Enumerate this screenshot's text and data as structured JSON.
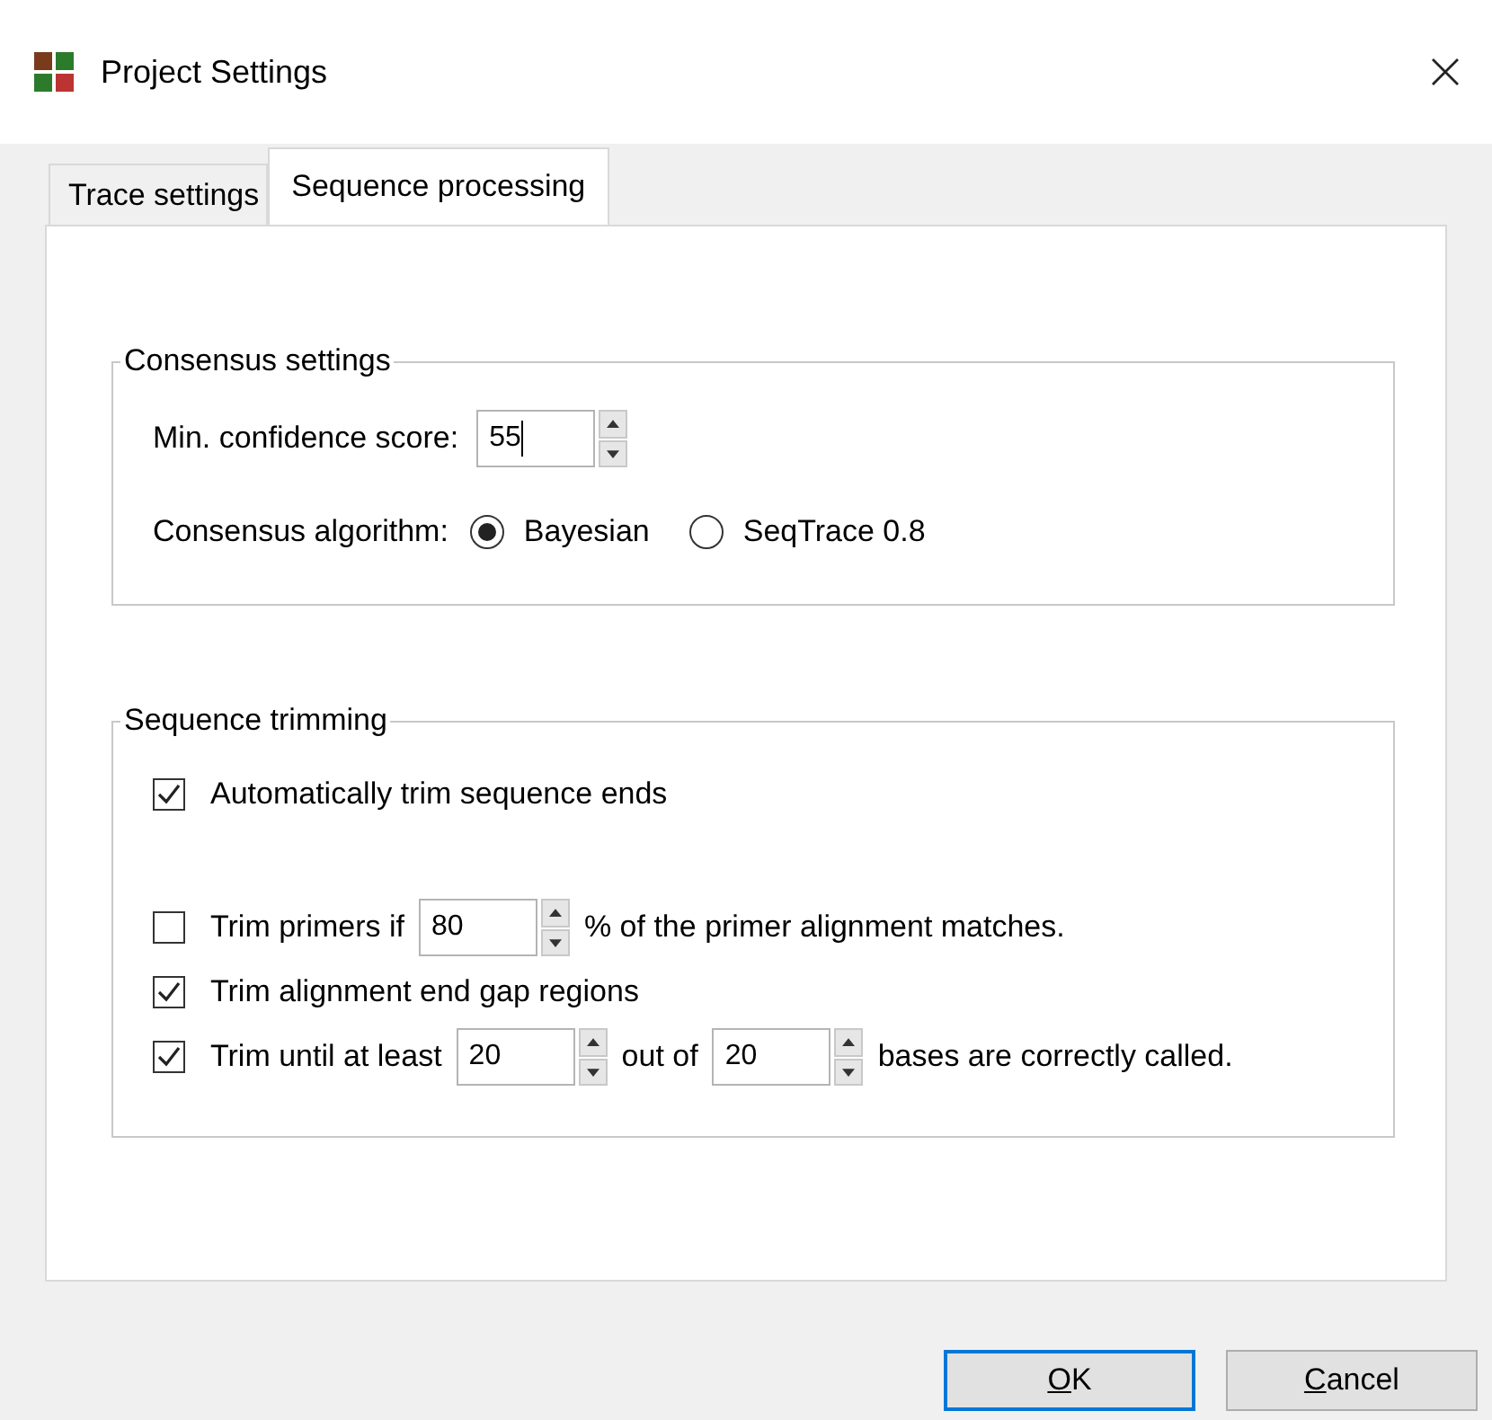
{
  "window": {
    "title": "Project Settings"
  },
  "tabs": [
    {
      "label": "Trace settings",
      "selected": false
    },
    {
      "label": "Sequence processing",
      "selected": true
    }
  ],
  "consensus_settings": {
    "title": "Consensus settings",
    "min_confidence": {
      "label": "Min. confidence score:",
      "value": "55",
      "focused": true
    },
    "algorithm": {
      "label": "Consensus algorithm:",
      "options": [
        {
          "label": "Bayesian",
          "selected": true
        },
        {
          "label": "SeqTrace 0.8",
          "selected": false
        }
      ]
    }
  },
  "sequence_trimming": {
    "title": "Sequence trimming",
    "rows": [
      {
        "checked": true,
        "parts": [
          {
            "kind": "text",
            "text": "Automatically trim sequence ends"
          }
        ]
      },
      {
        "checked": false,
        "parts": [
          {
            "kind": "text",
            "text": "Trim primers if"
          },
          {
            "kind": "spin",
            "value": "80"
          },
          {
            "kind": "text",
            "text": "% of the primer alignment matches."
          }
        ]
      },
      {
        "checked": true,
        "parts": [
          {
            "kind": "text",
            "text": "Trim alignment end gap regions"
          }
        ]
      },
      {
        "checked": true,
        "parts": [
          {
            "kind": "text",
            "text": "Trim until at least"
          },
          {
            "kind": "spin",
            "value": "20"
          },
          {
            "kind": "text",
            "text": "out of"
          },
          {
            "kind": "spin",
            "value": "20"
          },
          {
            "kind": "text",
            "text": "bases are correctly called."
          }
        ]
      }
    ]
  },
  "buttons": [
    {
      "label": "OK",
      "default": true
    },
    {
      "label": "Cancel",
      "default": false
    }
  ]
}
